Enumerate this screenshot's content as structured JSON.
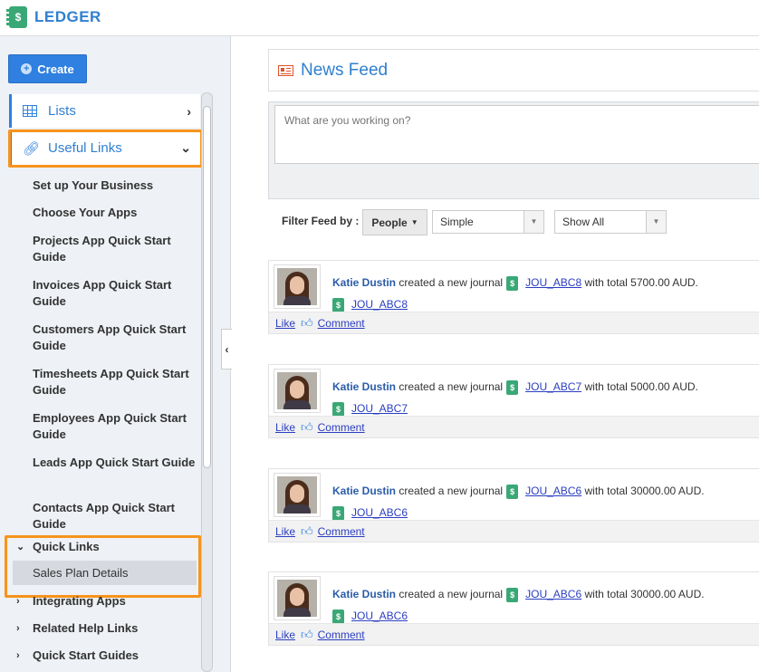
{
  "app": {
    "name": "LEDGER"
  },
  "sidebar": {
    "create_label": "Create",
    "lists_label": "Lists",
    "useful_links_label": "Useful Links",
    "useful_links": [
      "Set up Your Business",
      "Choose Your Apps",
      "Projects App Quick Start Guide",
      "Invoices App Quick Start Guide",
      "Customers App Quick Start Guide",
      "Timesheets App Quick Start Guide",
      "Employees App Quick Start Guide",
      "Leads App Quick Start Guide",
      "Contacts App Quick Start Guide"
    ],
    "quick_links_label": "Quick Links",
    "quick_links_items": [
      "Sales Plan Details"
    ],
    "integrating_apps_label": "Integrating Apps",
    "related_help_label": "Related Help Links",
    "quick_start_label": "Quick Start Guides"
  },
  "feed": {
    "title": "News Feed",
    "post_placeholder": "What are you working on?",
    "filter_label": "Filter Feed by :",
    "people_label": "People",
    "view_select": "Simple",
    "show_select": "Show All",
    "entries": [
      {
        "user": "Katie Dustin",
        "action": "created a new journal",
        "journal": "JOU_ABC8",
        "tail": "with total 5700.00 AUD."
      },
      {
        "user": "Katie Dustin",
        "action": "created a new journal",
        "journal": "JOU_ABC7",
        "tail": "with total 5000.00 AUD."
      },
      {
        "user": "Katie Dustin",
        "action": "created a new journal",
        "journal": "JOU_ABC6",
        "tail": "with total 30000.00 AUD."
      },
      {
        "user": "Katie Dustin",
        "action": "created a new journal",
        "journal": "JOU_ABC6",
        "tail": "with total 30000.00 AUD."
      }
    ],
    "like_label": "Like",
    "comment_label": "Comment"
  },
  "colors": {
    "accent": "#2f80e0",
    "highlight": "#f7941d",
    "ledger_green": "#3aa876"
  }
}
